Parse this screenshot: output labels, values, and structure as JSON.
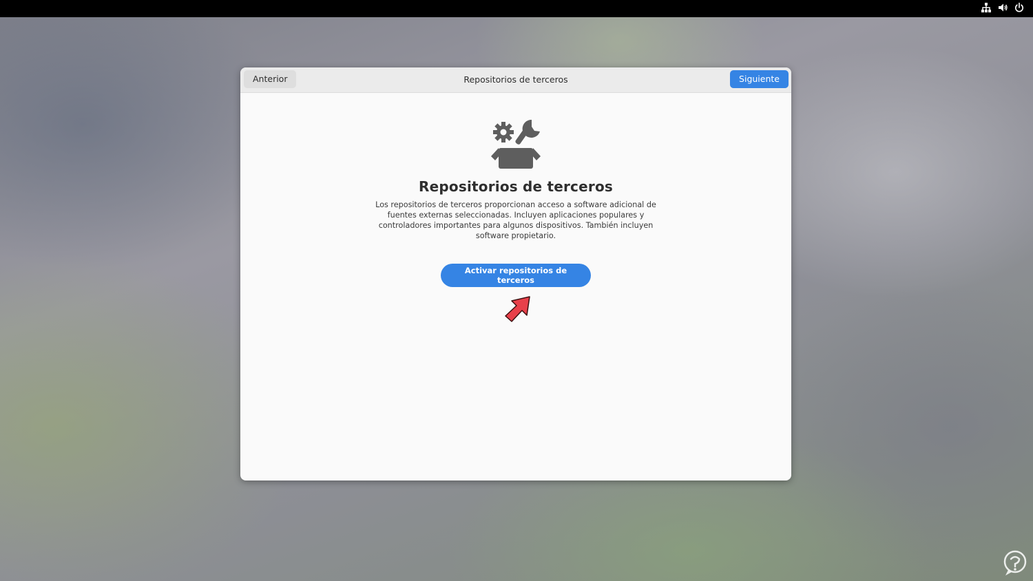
{
  "system_tray": {
    "icons": [
      "network-icon",
      "volume-icon",
      "power-icon"
    ]
  },
  "window": {
    "title": "Repositorios de terceros",
    "back_label": "Anterior",
    "next_label": "Siguiente"
  },
  "page": {
    "icon": "repositories-icon",
    "title": "Repositorios de terceros",
    "description": "Los repositorios de terceros proporcionan acceso a software adicional de fuentes externas seleccionadas. Incluyen aplicaciones populares y controladores importantes para algunos dispositivos. También incluyen software propietario.",
    "activate_label": "Activar repositorios de terceros"
  },
  "colors": {
    "accent": "#3584e4",
    "topbar": "#000000",
    "annotation_arrow": "#e8404a"
  }
}
